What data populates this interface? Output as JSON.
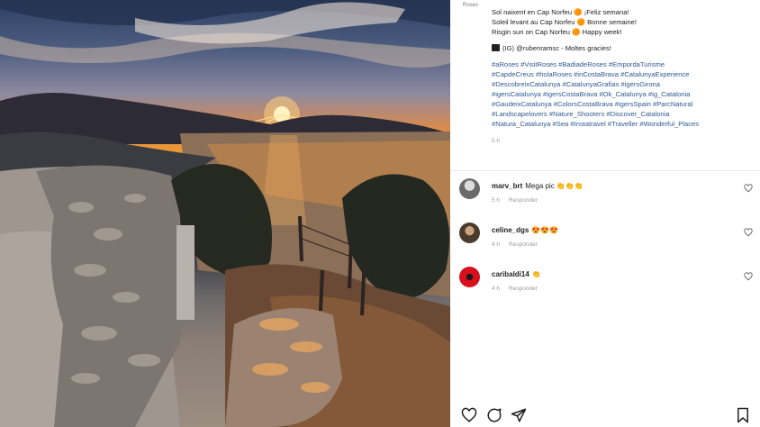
{
  "post": {
    "top_label": "Roses",
    "caption_lines": [
      "Sol naixent en Cap Norfeu 🟠 ¡Feliz semana!",
      "Soleil levant au Cap Norfeu 🟠 Bonne semaine!",
      "Risgin sun on Cap Norfeu 🟠 Happy week!"
    ],
    "credit": "(IG) @rubenramsc - Moltes gracies!",
    "hashtag_lines": [
      "#aRoses #VisitRoses #BadiadeRoses #EmpordaTurisme",
      "#CapdeCreus #holaRoses #inCostaBrava #CatalunyaExperience",
      "#DescobreixCatalunya #CatalunyaGrafias #igersGirona",
      "#igersCatalunya #igersCostaBrava #Ok_Catalunya #ig_Catalonia",
      "#GaudeixCatalunya #ColorsCostaBrava #igersSpain #ParcNatural",
      "#Landscapelovers #Nature_Shooters #Discover_Catalonia",
      "#Natura_Catalunya #Sea #Instatravel #Traveller #Wonderful_Places"
    ],
    "time": "5 h"
  },
  "comments": [
    {
      "user": "marv_brt",
      "text": "Mega pic 👏👏👏",
      "time": "5 h",
      "reply": "Responder",
      "avatar_color": "#6b6b6b"
    },
    {
      "user": "celine_dgs",
      "text": "😍😍😍",
      "time": "4 h",
      "reply": "Responder",
      "avatar_color": "#4a3b2c"
    },
    {
      "user": "caribaldi14",
      "text": "👏",
      "time": "4 h",
      "reply": "Responder",
      "avatar_color": "#d8101e"
    }
  ],
  "icons": {
    "like": "heart-icon",
    "comment": "comment-icon",
    "share": "send-icon",
    "save": "bookmark-icon"
  }
}
